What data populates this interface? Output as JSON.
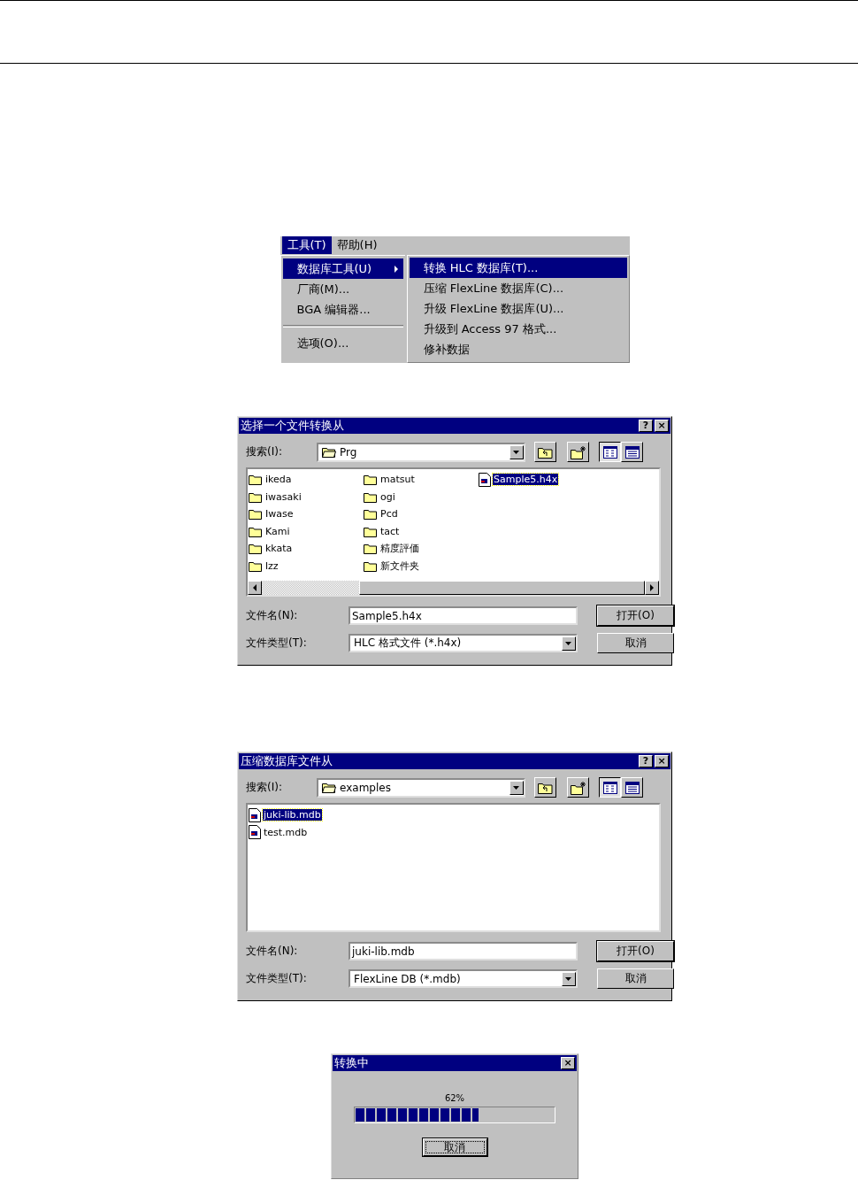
{
  "menu": {
    "menubar": [
      {
        "label": "工具(T)",
        "selected": true
      },
      {
        "label": "帮助(H)",
        "selected": false
      }
    ],
    "dropdown": [
      {
        "kind": "item",
        "label": "数据库工具(U)",
        "selected": true,
        "has_submenu": true
      },
      {
        "kind": "item",
        "label": "厂商(M)...",
        "selected": false,
        "has_submenu": false
      },
      {
        "kind": "item",
        "label": "BGA 编辑器...",
        "selected": false,
        "has_submenu": false
      },
      {
        "kind": "separator"
      },
      {
        "kind": "item",
        "label": "选项(O)...",
        "selected": false,
        "has_submenu": false
      }
    ],
    "submenu": [
      {
        "label": "转换 HLC 数据库(T)...",
        "selected": true
      },
      {
        "label": "压缩 FlexLine 数据库(C)...",
        "selected": false
      },
      {
        "label": "升级  FlexLine 数据库(U)...",
        "selected": false
      },
      {
        "label": "升级到 Access 97 格式...",
        "selected": false
      },
      {
        "label": "修补数据",
        "selected": false
      }
    ]
  },
  "file_dialogs": [
    {
      "title": "选择一个文件转换从",
      "title_buttons": [
        "?",
        "×"
      ],
      "look_in_label": "搜索(I):",
      "look_in": "Prg",
      "views": [
        {
          "kind": "list",
          "selected": true
        },
        {
          "kind": "details",
          "selected": false
        }
      ],
      "horizontal_scrollbar": true,
      "files": [
        {
          "kind": "folder",
          "name": "ikeda",
          "selected": false
        },
        {
          "kind": "folder",
          "name": "iwasaki",
          "selected": false
        },
        {
          "kind": "folder",
          "name": "Iwase",
          "selected": false
        },
        {
          "kind": "folder",
          "name": "Kami",
          "selected": false
        },
        {
          "kind": "folder",
          "name": "kkata",
          "selected": false
        },
        {
          "kind": "folder",
          "name": "lzz",
          "selected": false
        },
        {
          "kind": "folder",
          "name": "matsut",
          "selected": false
        },
        {
          "kind": "folder",
          "name": "ogi",
          "selected": false
        },
        {
          "kind": "folder",
          "name": "Pcd",
          "selected": false
        },
        {
          "kind": "folder",
          "name": "tact",
          "selected": false
        },
        {
          "kind": "folder",
          "name": "精度評価",
          "selected": false
        },
        {
          "kind": "folder",
          "name": "新文件夹",
          "selected": false
        },
        {
          "kind": "file",
          "name": "Sample5.h4x",
          "selected": true
        }
      ],
      "filename_label": "文件名(N):",
      "filename": "Sample5.h4x",
      "filetype_label": "文件类型(T):",
      "filetype": "HLC 格式文件 (*.h4x)",
      "buttons": [
        "打开(O)",
        "取消"
      ]
    },
    {
      "title": "压缩数据库文件从",
      "title_buttons": [
        "?",
        "×"
      ],
      "look_in_label": "搜索(I):",
      "look_in": "examples",
      "views": [
        {
          "kind": "list",
          "selected": true
        },
        {
          "kind": "details",
          "selected": false
        }
      ],
      "horizontal_scrollbar": false,
      "files": [
        {
          "kind": "file",
          "name": "juki-lib.mdb",
          "selected": true
        },
        {
          "kind": "file",
          "name": "test.mdb",
          "selected": false
        }
      ],
      "filename_label": "文件名(N):",
      "filename": "juki-lib.mdb",
      "filetype_label": "文件类型(T):",
      "filetype": "FlexLine DB (*.mdb)",
      "buttons": [
        "打开(O)",
        "取消"
      ]
    }
  ],
  "progress_dialog": {
    "title": "转换中",
    "close_button": "×",
    "percent": "62%",
    "level": 0.62,
    "button": "取消"
  }
}
